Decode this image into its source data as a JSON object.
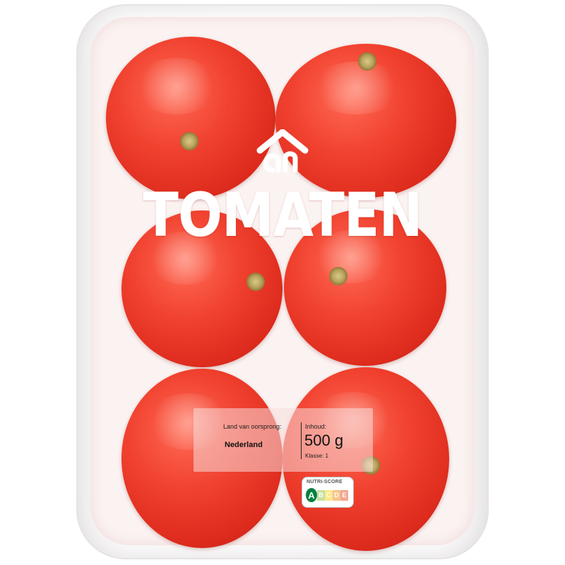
{
  "product": {
    "title": "TOMATEN",
    "brand_logo_icon": "ah-logo-icon",
    "origin_caption": "Land van oorsprong:",
    "origin_value": "Nederland",
    "content_caption": "Inhoud:",
    "content_value": "500 g",
    "class_caption": "Klasse: 1"
  },
  "nutriscore": {
    "title": "NUTRI-SCORE",
    "active": "A",
    "grades": [
      {
        "letter": "A",
        "color": "#038141"
      },
      {
        "letter": "B",
        "color": "#85bb2f"
      },
      {
        "letter": "C",
        "color": "#fecb02"
      },
      {
        "letter": "D",
        "color": "#ee8100"
      },
      {
        "letter": "E",
        "color": "#e63e11"
      }
    ]
  },
  "colors": {
    "tomato": "#e8362a",
    "tray": "#fbf3f2",
    "logo": "#ffffff"
  }
}
